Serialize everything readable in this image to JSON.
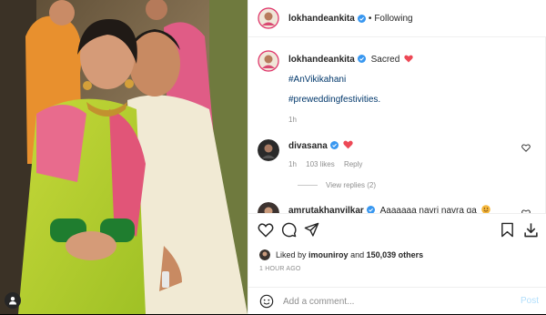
{
  "post": {
    "author": "lokhandeankita",
    "verified": true,
    "follow_status": "Following",
    "dot": "•"
  },
  "caption": {
    "username": "lokhandeankita",
    "text": "Sacred",
    "emoji": "heart-red",
    "hashtags": [
      "#AnVikikahani",
      "#preweddingfestivities."
    ],
    "time": "1h"
  },
  "comments": [
    {
      "username": "divasana",
      "verified": true,
      "emoji": "heart-red",
      "time": "1h",
      "likes": "103 likes",
      "reply_label": "Reply",
      "view_replies": "View replies (2)"
    },
    {
      "username": "amrutakhanvilkar",
      "verified": true,
      "text": "Aaaaaaa navri navra ga",
      "emoji": "smiling-face"
    }
  ],
  "actions": {
    "icons": [
      "heart-icon",
      "comment-icon",
      "share-icon",
      "save-icon",
      "download-icon"
    ]
  },
  "likes": {
    "prefix": "Liked by",
    "user": "imouniroy",
    "and": "and",
    "count": "150,039 others"
  },
  "timestamp": "1 HOUR AGO",
  "add_comment": {
    "placeholder": "Add a comment...",
    "post_label": "Post"
  },
  "colors": {
    "link": "#00376b",
    "verified": "#3897f0",
    "muted": "#8e8e8e",
    "post_disabled": "#b2dffc",
    "heart": "#ed4956"
  }
}
